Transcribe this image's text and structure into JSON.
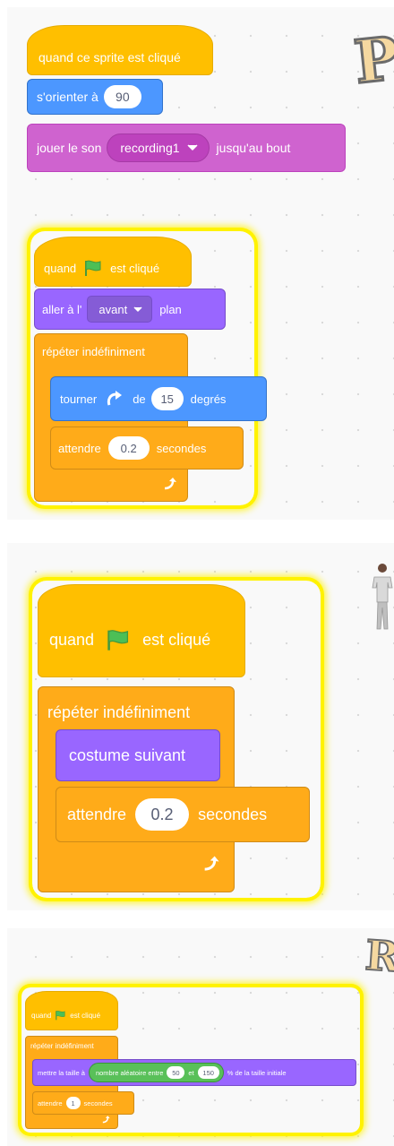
{
  "panel1": {
    "script1": {
      "hat_label": "quand ce sprite est cliqué",
      "point_label": "s'orienter à",
      "point_value": "90",
      "sound_label_before": "jouer le son",
      "sound_value": "recording1",
      "sound_label_after": "jusqu'au bout"
    },
    "script2": {
      "hat_label_before": "quand",
      "hat_label_after": "est cliqué",
      "layer_label_before": "aller à l'",
      "layer_value": "avant",
      "layer_label_after": "plan",
      "forever_label": "répéter indéfiniment",
      "turn_label_before": "tourner",
      "turn_value": "15",
      "turn_label_after": "degrés",
      "wait_label_before": "attendre",
      "wait_value": "0.2",
      "wait_label_after": "secondes"
    },
    "corner_letter": "P"
  },
  "panel2": {
    "hat_label_before": "quand",
    "hat_label_after": "est cliqué",
    "forever_label": "répéter indéfiniment",
    "costume_label": "costume suivant",
    "wait_label_before": "attendre",
    "wait_value": "0.2",
    "wait_label_after": "secondes"
  },
  "panel3": {
    "hat_label_before": "quand",
    "hat_label_after": "est cliqué",
    "forever_label": "répéter indéfiniment",
    "size_label_before": "mettre la taille à",
    "random_label_before": "nombre aléatoire entre",
    "random_min": "50",
    "random_label_mid": "et",
    "random_max": "150",
    "size_label_after": "% de la taille initiale",
    "wait_label_before": "attendre",
    "wait_value": "1",
    "wait_label_after": "secondes",
    "corner_letter": "R"
  },
  "colors": {
    "events": "#ffbf00",
    "motion": "#4c97ff",
    "sound": "#cf63cf",
    "looks": "#9966ff",
    "control": "#ffab19",
    "operators": "#59c059",
    "highlight": "#fff200"
  }
}
